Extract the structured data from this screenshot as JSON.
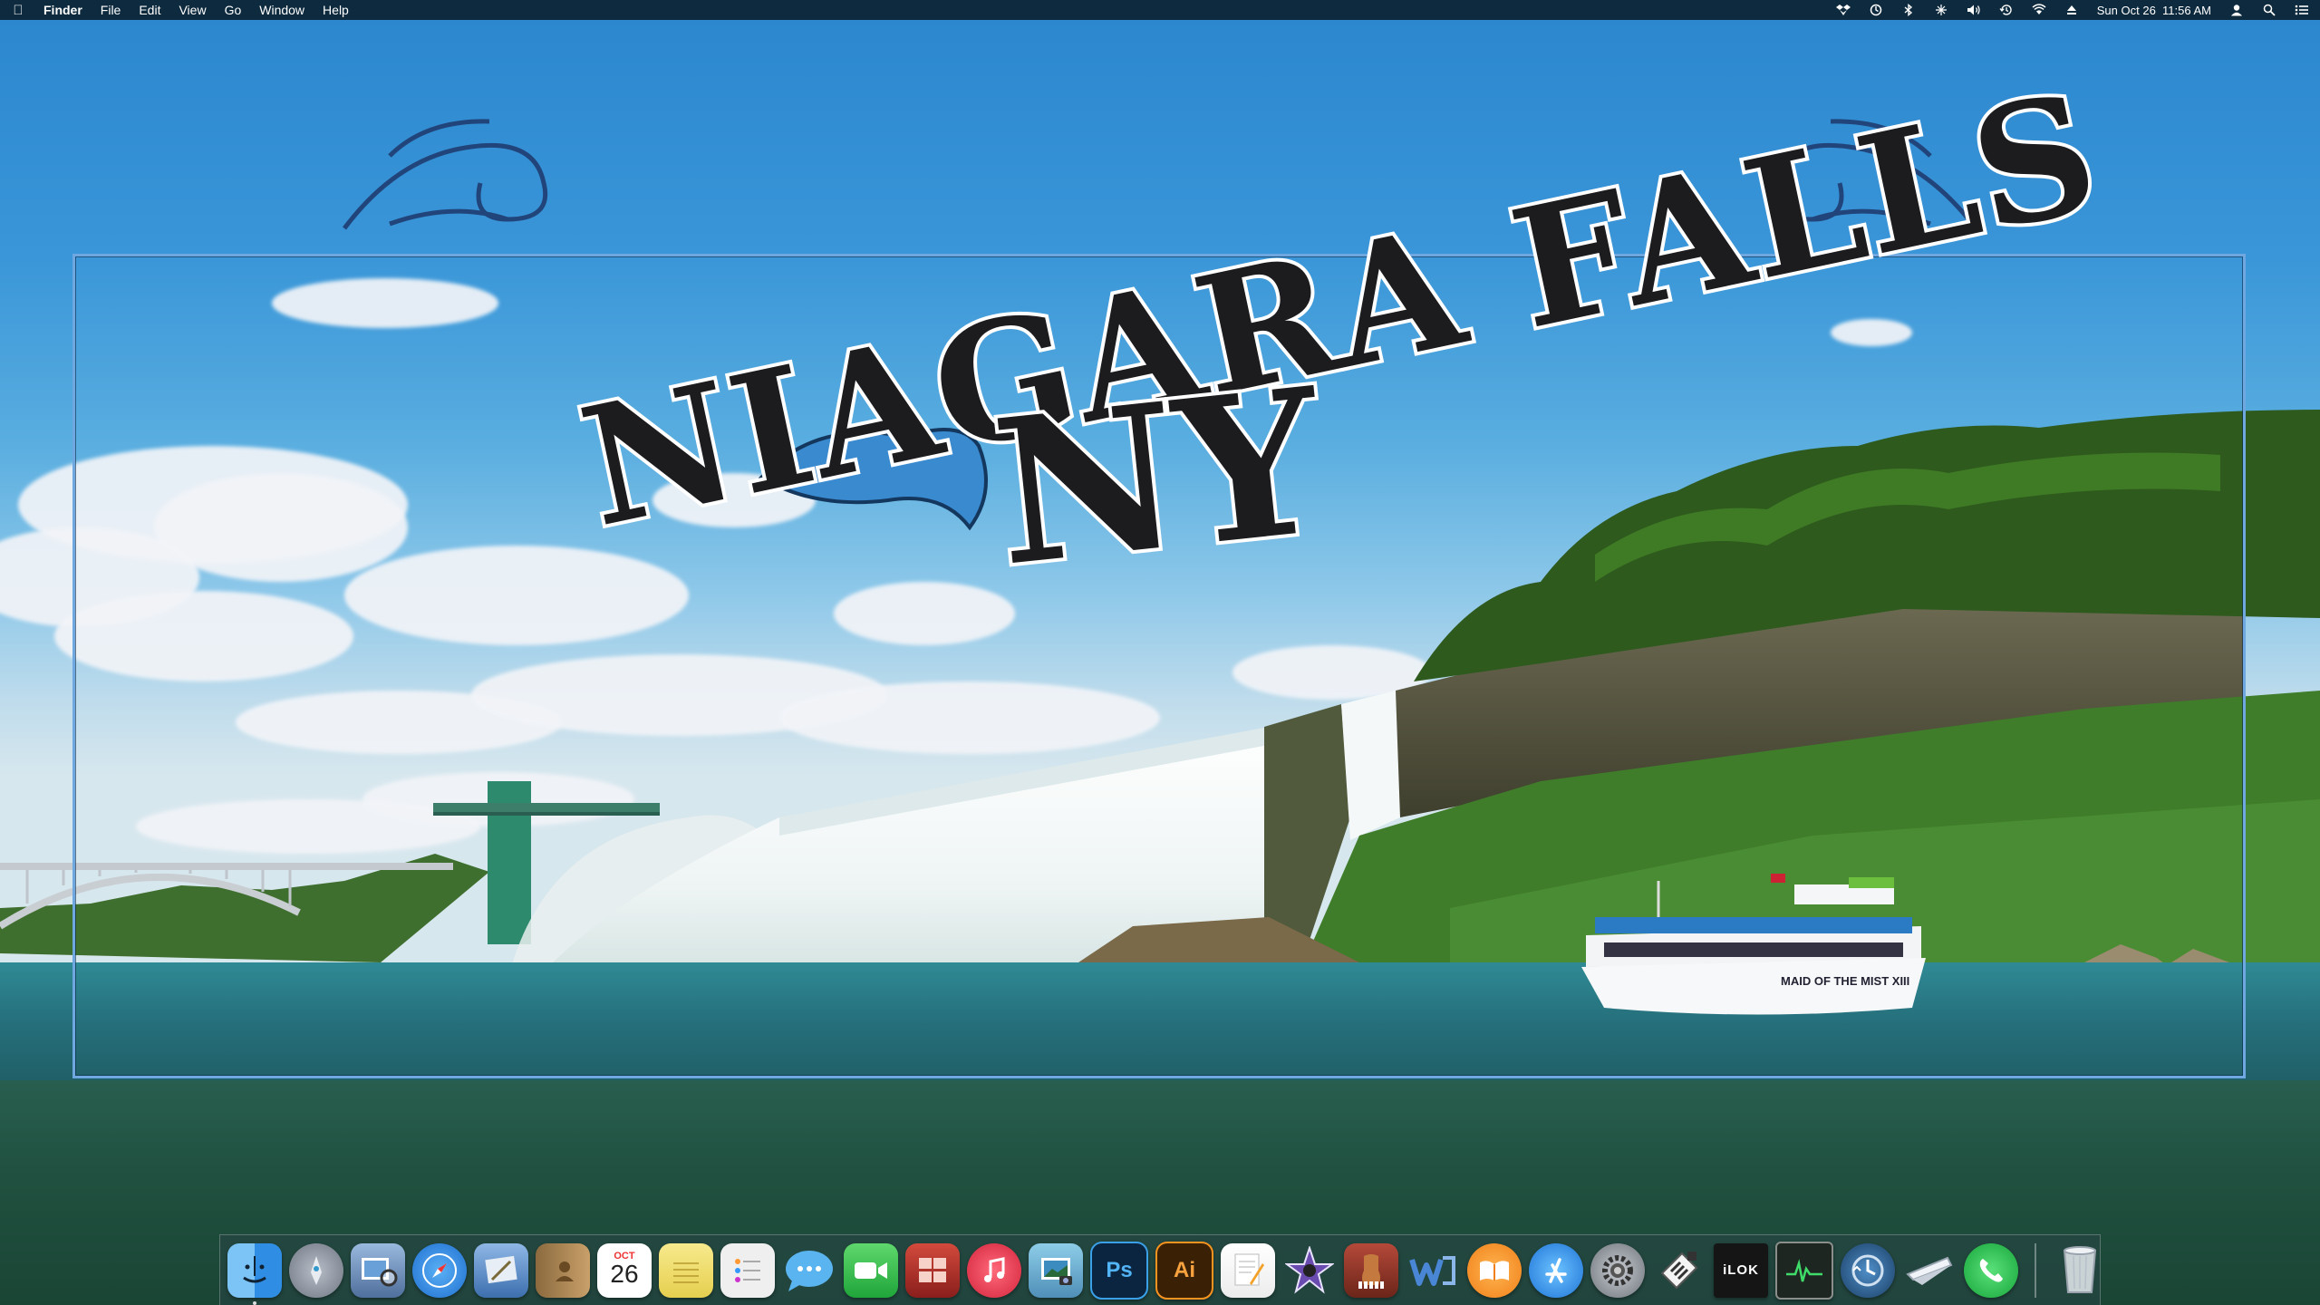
{
  "menubar": {
    "apple_icon": "apple-logo-icon",
    "app_name": "Finder",
    "menus": [
      "File",
      "Edit",
      "View",
      "Go",
      "Window",
      "Help"
    ],
    "status_icons": [
      "dropbox-icon",
      "clock-icon",
      "bluetooth-icon",
      "network-icon",
      "volume-icon",
      "time-machine-icon",
      "wifi-icon",
      "eject-icon"
    ],
    "datetime": "Sun Oct 26  11:56 AM",
    "user_icon": "user-icon",
    "search_icon": "spotlight-search-icon",
    "notification_icon": "notification-center-icon"
  },
  "wallpaper": {
    "title_line1": "NIAGARA FALLS",
    "title_line2": "NY",
    "boat_label": "MAID OF THE MIST XIII",
    "frame_color": "#6fa8e0"
  },
  "dock": {
    "calendar_month": "OCT",
    "calendar_day": "26",
    "photoshop_label": "Ps",
    "illustrator_label": "Ai",
    "ilok_label": "iLOK",
    "items": [
      {
        "name": "finder-icon",
        "color": "#2f8de4",
        "running": true
      },
      {
        "name": "launchpad-icon",
        "color": "#8a94a3"
      },
      {
        "name": "preview-icon",
        "color": "#6a89b3"
      },
      {
        "name": "safari-icon",
        "color": "#2f86e6"
      },
      {
        "name": "mail-icon",
        "color": "#5f8fc4"
      },
      {
        "name": "contacts-icon",
        "color": "#b08a5a"
      },
      {
        "name": "calendar-icon",
        "color": "#ffffff"
      },
      {
        "name": "notes-icon",
        "color": "#f3e27a"
      },
      {
        "name": "reminders-icon",
        "color": "#e9e9e9"
      },
      {
        "name": "messages-icon",
        "color": "#4aa6ec"
      },
      {
        "name": "facetime-icon",
        "color": "#2ebd49"
      },
      {
        "name": "photo-booth-icon",
        "color": "#b8302e"
      },
      {
        "name": "itunes-icon",
        "color": "#ea3c53"
      },
      {
        "name": "iphoto-icon",
        "color": "#5aa0c8"
      },
      {
        "name": "photoshop-icon",
        "color": "#0a2a4a"
      },
      {
        "name": "illustrator-icon",
        "color": "#3a2208"
      },
      {
        "name": "pages-icon",
        "color": "#f1a33b"
      },
      {
        "name": "imovie-icon",
        "color": "#5a3e8e"
      },
      {
        "name": "garageband-icon",
        "color": "#a43a2a"
      },
      {
        "name": "wunderlist-icon",
        "color": "#3d72c4"
      },
      {
        "name": "ibooks-icon",
        "color": "#f28a1e"
      },
      {
        "name": "app-store-icon",
        "color": "#2a86e4"
      },
      {
        "name": "system-preferences-icon",
        "color": "#8a8f96"
      },
      {
        "name": "script-editor-icon",
        "color": "#dcdcdc"
      },
      {
        "name": "ilok-icon",
        "color": "#1c1c1c"
      },
      {
        "name": "activity-monitor-icon",
        "color": "#222a26"
      },
      {
        "name": "time-machine-icon",
        "color": "#2a5c8c"
      },
      {
        "name": "airmail-icon",
        "color": "#c9d2dd"
      },
      {
        "name": "phone-app-icon",
        "color": "#2ec94b"
      },
      {
        "name": "trash-icon",
        "color": "#d6dbe0"
      }
    ]
  }
}
